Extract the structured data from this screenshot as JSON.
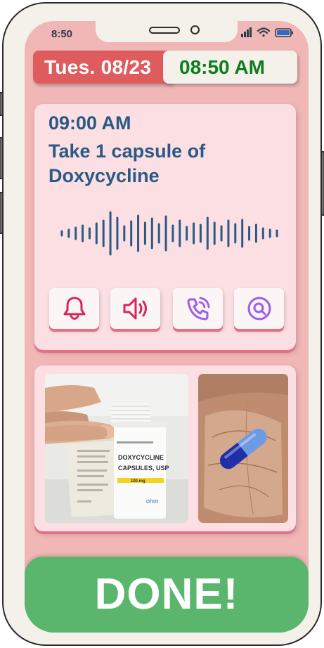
{
  "status_bar": {
    "time": "8:50",
    "icons": [
      "signal-icon",
      "wifi-icon",
      "battery-icon"
    ]
  },
  "header": {
    "date": "Tues. 08/23",
    "current_time": "08:50 AM"
  },
  "reminder": {
    "time": "09:00 AM",
    "text": "Take 1 capsule of Doxycycline",
    "audio_visual": "waveform",
    "controls": [
      "bell-icon",
      "speaker-icon",
      "phone-call-icon",
      "search-icon"
    ]
  },
  "photos": {
    "bottle": {
      "brand_line": "DOXYCYCLINE",
      "brand_line2": "CAPSULES, USP",
      "dose": "100 mg",
      "maker": "ohm"
    }
  },
  "done_button": {
    "label": "DONE!"
  },
  "colors": {
    "screen_bg": "#f0b7b6",
    "date_bg": "#de5c5e",
    "time_fg": "#0e7c1f",
    "card_bg": "#fcdfe3",
    "heading_fg": "#2a5a84",
    "accent": "#e46f86",
    "done_bg": "#5ab56d"
  }
}
